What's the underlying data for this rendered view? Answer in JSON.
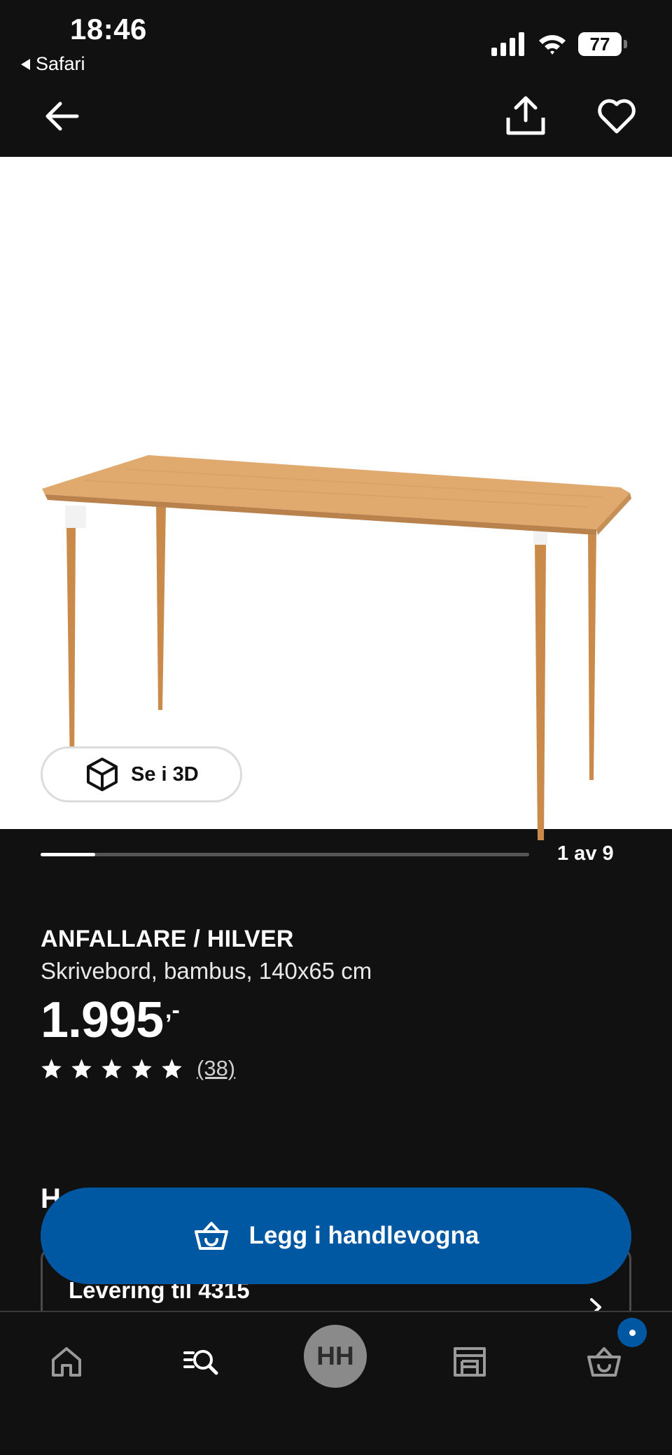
{
  "status_bar": {
    "time": "18:46",
    "back_app": "Safari",
    "battery": "77",
    "icons": [
      "signal-icon",
      "wifi-icon",
      "battery-icon"
    ]
  },
  "nav": {
    "icons": [
      "back-arrow-icon",
      "share-icon",
      "heart-icon"
    ]
  },
  "gallery": {
    "see_3d_label": "Se i 3D",
    "counter": "1 av 9",
    "current_image": 1,
    "total_images": 9
  },
  "product": {
    "name": "ANFALLARE / HILVER",
    "description": "Skrivebord, bambus, 140x65 cm",
    "price": "1.995",
    "price_suffix": ",-",
    "rating_stars": 5,
    "review_count": "(38)"
  },
  "partially_hidden": {
    "section_heading": "H",
    "delivery_label": "Levering til 4315"
  },
  "cta": {
    "label": "Legg i handlevogna"
  },
  "tab_bar": {
    "profile_initials": "HH",
    "icons": [
      "home-icon",
      "search-icon",
      "store-icon",
      "basket-icon"
    ]
  },
  "colors": {
    "background": "#111111",
    "accent": "#0058a3",
    "image_background": "#ffffff",
    "wood": "#d9a46a"
  }
}
